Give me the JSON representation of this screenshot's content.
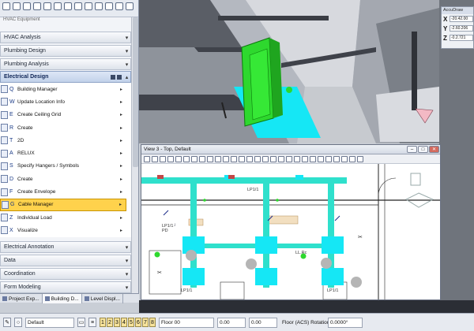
{
  "toolbar_icons": [
    "arrow",
    "hash",
    "doc",
    "grid",
    "A",
    "arrow",
    "arrow",
    "cross",
    "pen",
    "globe",
    "shape",
    "shape",
    "grid"
  ],
  "panel": {
    "ghost_label": "HVAC Equipment",
    "sections_top": [
      {
        "label": "HVAC Analysis"
      },
      {
        "label": "Plumbing Design"
      },
      {
        "label": "Plumbing Analysis"
      }
    ],
    "electrical": {
      "label": "Electrical Design",
      "items": [
        {
          "key": "Q",
          "label": "Building Manager",
          "arrow": "▸"
        },
        {
          "key": "W",
          "label": "Update Location Info",
          "arrow": "▸"
        },
        {
          "key": "E",
          "label": "Create Ceiling Grid",
          "arrow": "▸"
        },
        {
          "key": "R",
          "label": "Create",
          "arrow": "▸"
        },
        {
          "key": "T",
          "label": "2D",
          "arrow": "▸"
        },
        {
          "key": "A",
          "label": "RELUX",
          "arrow": "▸"
        },
        {
          "key": "S",
          "label": "Specify Hangers / Symbols",
          "arrow": "▸"
        },
        {
          "key": "D",
          "label": "Create",
          "arrow": "▸"
        },
        {
          "key": "F",
          "label": "Create Envelope",
          "arrow": "▸"
        },
        {
          "key": "G",
          "label": "Cable Manager",
          "arrow": "▸",
          "selected": true
        },
        {
          "key": "Z",
          "label": "Individual Load",
          "arrow": "▸"
        },
        {
          "key": "X",
          "label": "Visualize",
          "arrow": "▸"
        }
      ]
    },
    "sections_bottom": [
      {
        "label": "Electrical Annotation"
      },
      {
        "label": "Data"
      },
      {
        "label": "Coordination"
      },
      {
        "label": "Form Modeling"
      }
    ]
  },
  "tabs": [
    {
      "label": "Project Exp..."
    },
    {
      "label": "Building D...",
      "active": true
    },
    {
      "label": "Level Displ..."
    }
  ],
  "accudraw": {
    "title": "AccuDraw",
    "rows": [
      {
        "axis": "X",
        "value": "-20.42.00"
      },
      {
        "axis": "Y",
        "value": "-2.60.206"
      },
      {
        "axis": "Z",
        "value": "-0.2.721"
      }
    ]
  },
  "view3": {
    "title": "View 3 - Top, Default",
    "labels": {
      "lp1": "LP1/1",
      "lp2": "LP1/1",
      "lp3": "LP1/1",
      "lp4": "LP1/1",
      "lr": "LL.Rc",
      "pd": "PD"
    }
  },
  "status": {
    "level_value": "Default",
    "scale_value": "0.00",
    "floor_label": "Floor 00",
    "coord": "0.00",
    "rotation_label": "Floor (ACS) Rotation",
    "rotation_value": "0.0000°",
    "nums": [
      "1",
      "2",
      "3",
      "4",
      "5",
      "6",
      "7",
      "8"
    ]
  },
  "colors": {
    "duct": "#2fe0cc",
    "plant": "#2ed82e",
    "cyan": "#15e7f5",
    "selected": "#ffd24c"
  }
}
